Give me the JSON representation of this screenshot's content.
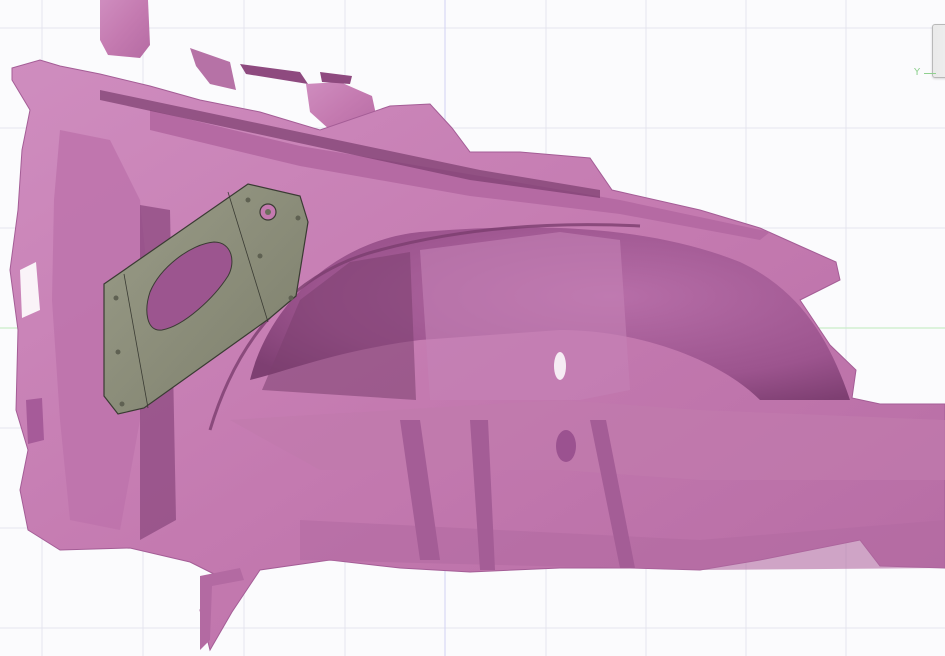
{
  "viewport": {
    "axis_label": "Y",
    "colors": {
      "background": "#fbfbfd",
      "grid_line": "#e4e4ee",
      "axis_x": "#d8d8f4",
      "axis_y": "#c9edc9",
      "scan_surface": "#c47ab0",
      "scan_shadow": "#8e4a7f",
      "bracket": "#8a8c78",
      "bracket_edge": "#3a3b33"
    },
    "icons": {
      "orientation_cube": "view-cube-icon"
    }
  }
}
